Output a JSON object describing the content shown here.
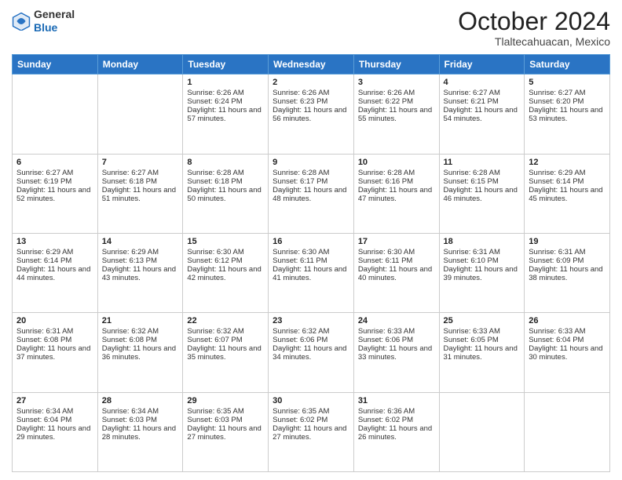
{
  "logo": {
    "general": "General",
    "blue": "Blue"
  },
  "title": "October 2024",
  "location": "Tlaltecahuacan, Mexico",
  "days_of_week": [
    "Sunday",
    "Monday",
    "Tuesday",
    "Wednesday",
    "Thursday",
    "Friday",
    "Saturday"
  ],
  "weeks": [
    [
      {
        "day": "",
        "sunrise": "",
        "sunset": "",
        "daylight": "",
        "empty": true
      },
      {
        "day": "",
        "sunrise": "",
        "sunset": "",
        "daylight": "",
        "empty": true
      },
      {
        "day": "1",
        "sunrise": "Sunrise: 6:26 AM",
        "sunset": "Sunset: 6:24 PM",
        "daylight": "Daylight: 11 hours and 57 minutes."
      },
      {
        "day": "2",
        "sunrise": "Sunrise: 6:26 AM",
        "sunset": "Sunset: 6:23 PM",
        "daylight": "Daylight: 11 hours and 56 minutes."
      },
      {
        "day": "3",
        "sunrise": "Sunrise: 6:26 AM",
        "sunset": "Sunset: 6:22 PM",
        "daylight": "Daylight: 11 hours and 55 minutes."
      },
      {
        "day": "4",
        "sunrise": "Sunrise: 6:27 AM",
        "sunset": "Sunset: 6:21 PM",
        "daylight": "Daylight: 11 hours and 54 minutes."
      },
      {
        "day": "5",
        "sunrise": "Sunrise: 6:27 AM",
        "sunset": "Sunset: 6:20 PM",
        "daylight": "Daylight: 11 hours and 53 minutes."
      }
    ],
    [
      {
        "day": "6",
        "sunrise": "Sunrise: 6:27 AM",
        "sunset": "Sunset: 6:19 PM",
        "daylight": "Daylight: 11 hours and 52 minutes."
      },
      {
        "day": "7",
        "sunrise": "Sunrise: 6:27 AM",
        "sunset": "Sunset: 6:18 PM",
        "daylight": "Daylight: 11 hours and 51 minutes."
      },
      {
        "day": "8",
        "sunrise": "Sunrise: 6:28 AM",
        "sunset": "Sunset: 6:18 PM",
        "daylight": "Daylight: 11 hours and 50 minutes."
      },
      {
        "day": "9",
        "sunrise": "Sunrise: 6:28 AM",
        "sunset": "Sunset: 6:17 PM",
        "daylight": "Daylight: 11 hours and 48 minutes."
      },
      {
        "day": "10",
        "sunrise": "Sunrise: 6:28 AM",
        "sunset": "Sunset: 6:16 PM",
        "daylight": "Daylight: 11 hours and 47 minutes."
      },
      {
        "day": "11",
        "sunrise": "Sunrise: 6:28 AM",
        "sunset": "Sunset: 6:15 PM",
        "daylight": "Daylight: 11 hours and 46 minutes."
      },
      {
        "day": "12",
        "sunrise": "Sunrise: 6:29 AM",
        "sunset": "Sunset: 6:14 PM",
        "daylight": "Daylight: 11 hours and 45 minutes."
      }
    ],
    [
      {
        "day": "13",
        "sunrise": "Sunrise: 6:29 AM",
        "sunset": "Sunset: 6:14 PM",
        "daylight": "Daylight: 11 hours and 44 minutes."
      },
      {
        "day": "14",
        "sunrise": "Sunrise: 6:29 AM",
        "sunset": "Sunset: 6:13 PM",
        "daylight": "Daylight: 11 hours and 43 minutes."
      },
      {
        "day": "15",
        "sunrise": "Sunrise: 6:30 AM",
        "sunset": "Sunset: 6:12 PM",
        "daylight": "Daylight: 11 hours and 42 minutes."
      },
      {
        "day": "16",
        "sunrise": "Sunrise: 6:30 AM",
        "sunset": "Sunset: 6:11 PM",
        "daylight": "Daylight: 11 hours and 41 minutes."
      },
      {
        "day": "17",
        "sunrise": "Sunrise: 6:30 AM",
        "sunset": "Sunset: 6:11 PM",
        "daylight": "Daylight: 11 hours and 40 minutes."
      },
      {
        "day": "18",
        "sunrise": "Sunrise: 6:31 AM",
        "sunset": "Sunset: 6:10 PM",
        "daylight": "Daylight: 11 hours and 39 minutes."
      },
      {
        "day": "19",
        "sunrise": "Sunrise: 6:31 AM",
        "sunset": "Sunset: 6:09 PM",
        "daylight": "Daylight: 11 hours and 38 minutes."
      }
    ],
    [
      {
        "day": "20",
        "sunrise": "Sunrise: 6:31 AM",
        "sunset": "Sunset: 6:08 PM",
        "daylight": "Daylight: 11 hours and 37 minutes."
      },
      {
        "day": "21",
        "sunrise": "Sunrise: 6:32 AM",
        "sunset": "Sunset: 6:08 PM",
        "daylight": "Daylight: 11 hours and 36 minutes."
      },
      {
        "day": "22",
        "sunrise": "Sunrise: 6:32 AM",
        "sunset": "Sunset: 6:07 PM",
        "daylight": "Daylight: 11 hours and 35 minutes."
      },
      {
        "day": "23",
        "sunrise": "Sunrise: 6:32 AM",
        "sunset": "Sunset: 6:06 PM",
        "daylight": "Daylight: 11 hours and 34 minutes."
      },
      {
        "day": "24",
        "sunrise": "Sunrise: 6:33 AM",
        "sunset": "Sunset: 6:06 PM",
        "daylight": "Daylight: 11 hours and 33 minutes."
      },
      {
        "day": "25",
        "sunrise": "Sunrise: 6:33 AM",
        "sunset": "Sunset: 6:05 PM",
        "daylight": "Daylight: 11 hours and 31 minutes."
      },
      {
        "day": "26",
        "sunrise": "Sunrise: 6:33 AM",
        "sunset": "Sunset: 6:04 PM",
        "daylight": "Daylight: 11 hours and 30 minutes."
      }
    ],
    [
      {
        "day": "27",
        "sunrise": "Sunrise: 6:34 AM",
        "sunset": "Sunset: 6:04 PM",
        "daylight": "Daylight: 11 hours and 29 minutes."
      },
      {
        "day": "28",
        "sunrise": "Sunrise: 6:34 AM",
        "sunset": "Sunset: 6:03 PM",
        "daylight": "Daylight: 11 hours and 28 minutes."
      },
      {
        "day": "29",
        "sunrise": "Sunrise: 6:35 AM",
        "sunset": "Sunset: 6:03 PM",
        "daylight": "Daylight: 11 hours and 27 minutes."
      },
      {
        "day": "30",
        "sunrise": "Sunrise: 6:35 AM",
        "sunset": "Sunset: 6:02 PM",
        "daylight": "Daylight: 11 hours and 27 minutes."
      },
      {
        "day": "31",
        "sunrise": "Sunrise: 6:36 AM",
        "sunset": "Sunset: 6:02 PM",
        "daylight": "Daylight: 11 hours and 26 minutes."
      },
      {
        "day": "",
        "sunrise": "",
        "sunset": "",
        "daylight": "",
        "empty": true
      },
      {
        "day": "",
        "sunrise": "",
        "sunset": "",
        "daylight": "",
        "empty": true
      }
    ]
  ]
}
